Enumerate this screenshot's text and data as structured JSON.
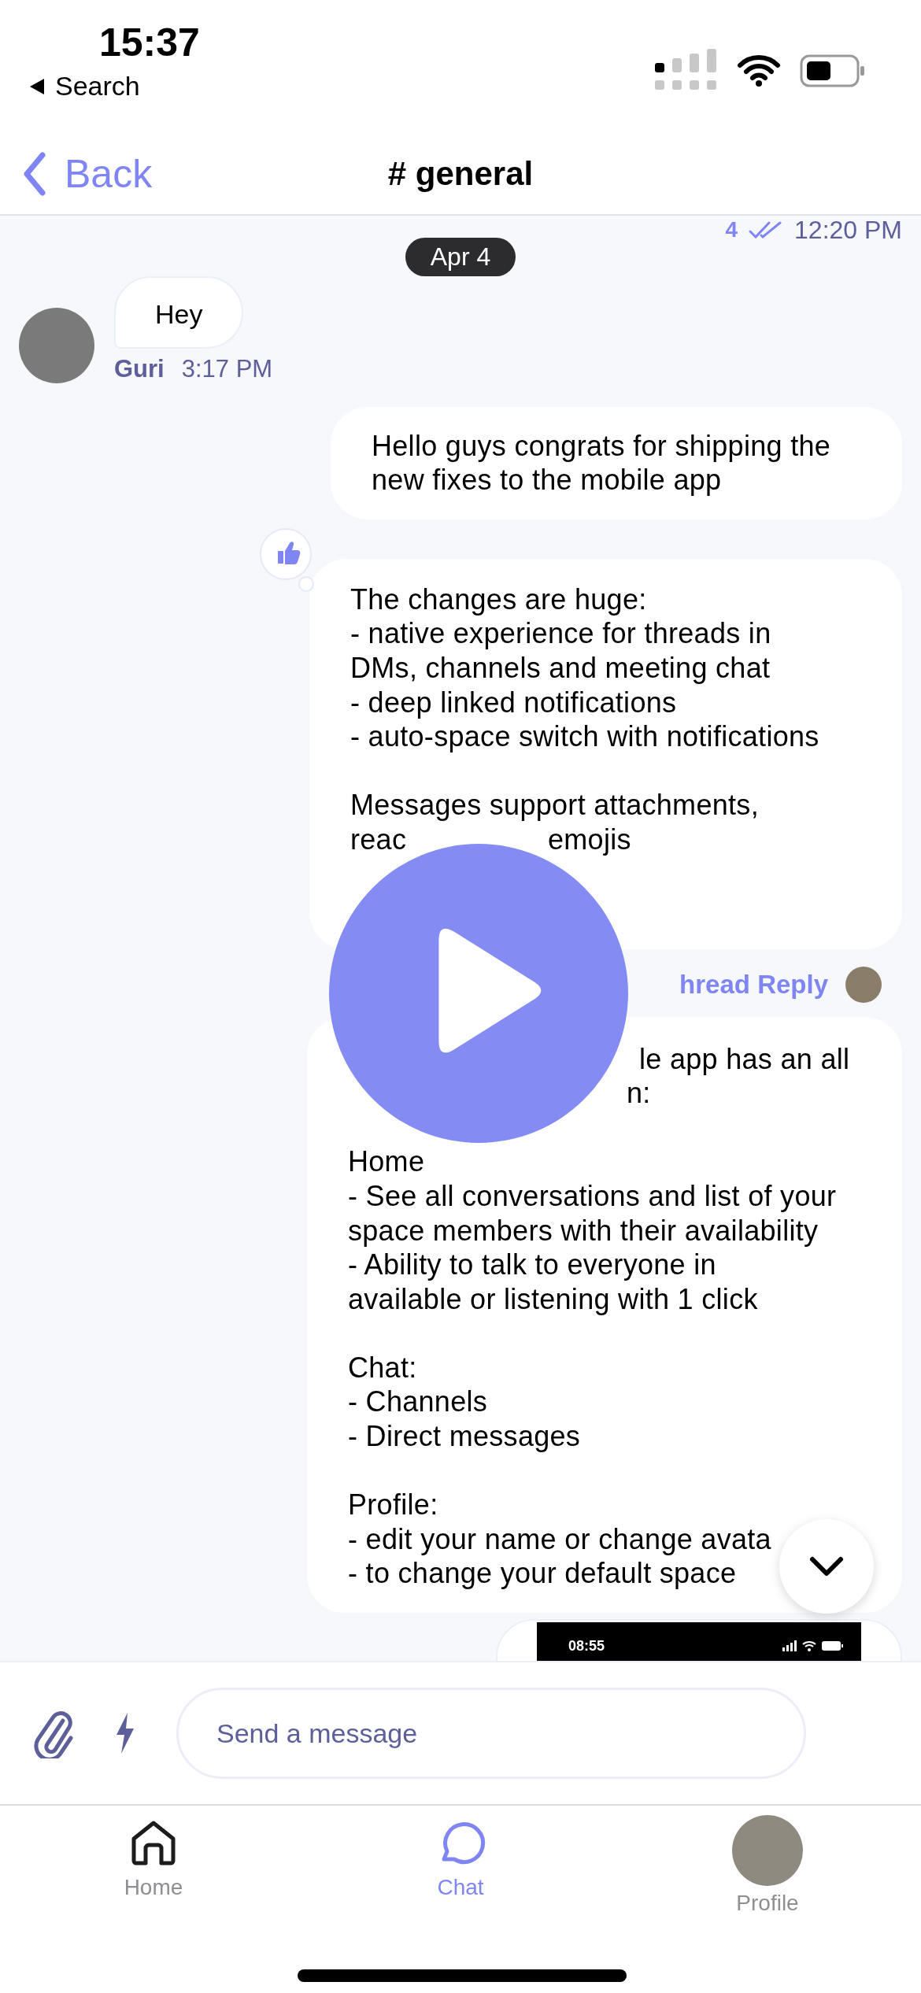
{
  "status_bar": {
    "time": "15:37",
    "back_app": "Search"
  },
  "nav": {
    "back": "Back",
    "title": "# general"
  },
  "read_receipt": {
    "count": "4",
    "time": "12:20 PM"
  },
  "date_pill": "Apr 4",
  "messages": [
    {
      "kind": "incoming",
      "sender": "Guri",
      "time": "3:17 PM",
      "paragraphs": [
        [
          {
            "kind": "plain",
            "text": "Hey"
          }
        ]
      ]
    },
    {
      "kind": "outgoing",
      "paragraphs": [
        [
          {
            "kind": "plain",
            "text": "Hello guys congrats for shipping the"
          },
          {
            "kind": "plain",
            "text": "new fixes to the mobile app"
          }
        ]
      ]
    },
    {
      "kind": "outgoing",
      "reaction": true,
      "paragraphs": [
        [
          {
            "kind": "plain",
            "text": "The changes are huge:"
          },
          {
            "kind": "plain",
            "text": "- native experience for threads in"
          },
          {
            "kind": "plain",
            "text": "DMs, channels and meeting chat"
          },
          {
            "kind": "plain",
            "text": "- deep linked notifications"
          },
          {
            "kind": "plain",
            "text": "- auto-space switch with notifications"
          }
        ],
        [
          {
            "kind": "plain",
            "text": "Messages support attachments,"
          },
          {
            "kind": "split",
            "parts": [
              "reac",
              "emojis"
            ]
          }
        ]
      ],
      "thread_reply": "hread Reply"
    },
    {
      "kind": "outgoing",
      "paragraphs": [
        [
          {
            "kind": "tail",
            "text": "le app has an all"
          },
          {
            "kind": "tail",
            "text": "n:"
          }
        ],
        [
          {
            "kind": "plain",
            "text": "Home"
          },
          {
            "kind": "plain",
            "text": "- See all conversations and list of your"
          },
          {
            "kind": "plain",
            "text": "space members with their availability"
          },
          {
            "kind": "plain",
            "text": "- Ability to talk to everyone in"
          },
          {
            "kind": "plain",
            "text": "available or listening with 1 click"
          }
        ],
        [
          {
            "kind": "plain",
            "text": "Chat:"
          },
          {
            "kind": "plain",
            "text": "- Channels"
          },
          {
            "kind": "plain",
            "text": "- Direct messages"
          }
        ],
        [
          {
            "kind": "plain",
            "text": "Profile:"
          },
          {
            "kind": "plain",
            "text": "- edit your name or change avata"
          },
          {
            "kind": "plain",
            "text": "- to change your default space"
          }
        ]
      ]
    },
    {
      "kind": "screenshot",
      "time": "08:55"
    }
  ],
  "composer": {
    "placeholder": "Send a message"
  },
  "tabs": [
    {
      "kind": "home",
      "label": "Home",
      "selected": false
    },
    {
      "kind": "chat",
      "label": "Chat",
      "selected": true
    },
    {
      "kind": "avatar",
      "label": "Profile",
      "selected": false
    }
  ]
}
